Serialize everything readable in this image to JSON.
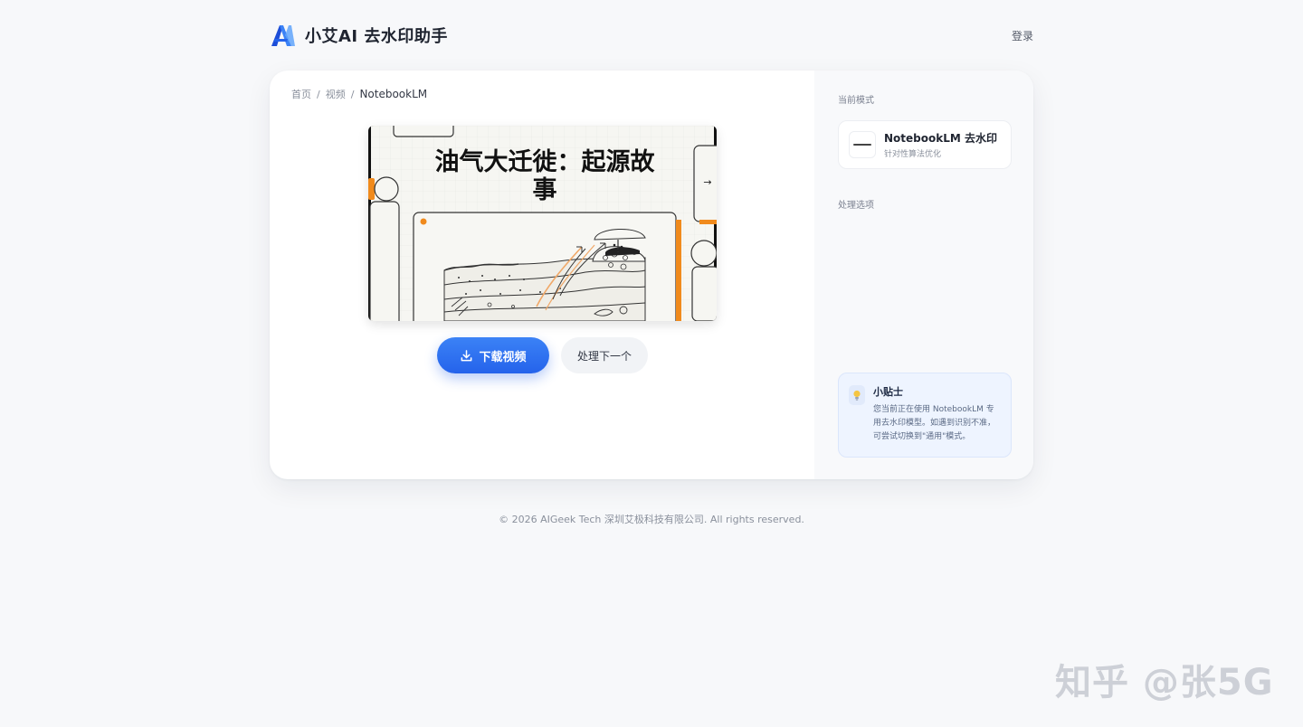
{
  "header": {
    "brand_name": "小艾AI 去水印助手",
    "login_label": "登录"
  },
  "breadcrumb": {
    "home": "首页",
    "separator": "/",
    "section": "视频",
    "current": "NotebookLM"
  },
  "video": {
    "title_line1": "油气大迁徙：起源故",
    "title_line2": "事",
    "nav_arrow": "→"
  },
  "actions": {
    "download_label": "下载视频",
    "next_label": "处理下一个"
  },
  "sidebar": {
    "current_mode_label": "当前模式",
    "mode_title": "NotebookLM 去水印",
    "mode_subtitle": "针对性算法优化",
    "options_label": "处理选项"
  },
  "tip": {
    "title": "小贴士",
    "text": "您当前正在使用 NotebookLM 专用去水印模型。如遇到识别不准，可尝试切换到\"通用\"模式。"
  },
  "footer": {
    "copyright": "© 2026 AIGeek Tech 深圳艾极科技有限公司. All rights reserved."
  },
  "watermark": {
    "text": "知乎 @张5G"
  },
  "colors": {
    "accent": "#2563eb",
    "page_bg": "#f7f8fa",
    "tip_bg": "#eef4ff",
    "video_orange": "#f08a1c"
  },
  "icons": {
    "logo": "stylized-A-logo",
    "download": "download-icon",
    "tip": "lightbulb-icon"
  }
}
